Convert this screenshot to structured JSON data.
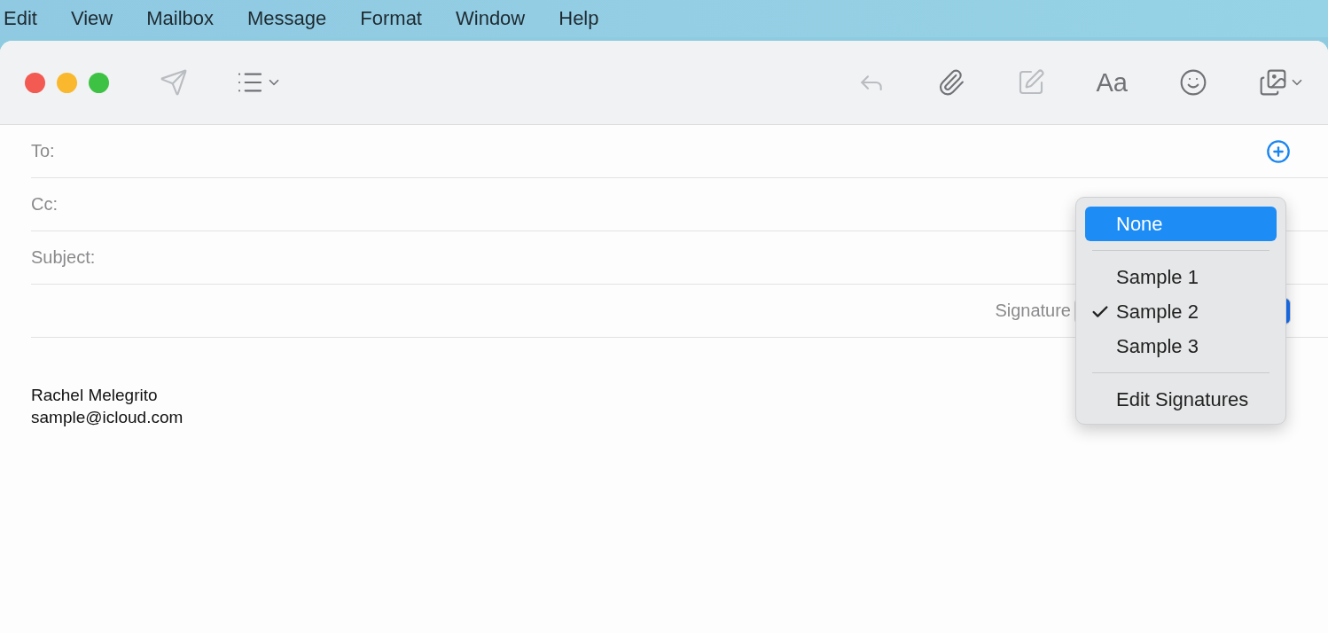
{
  "menu_bar": [
    "Edit",
    "View",
    "Mailbox",
    "Message",
    "Format",
    "Window",
    "Help"
  ],
  "toolbar": {
    "left": [
      {
        "kind": "send",
        "disabled": true
      },
      {
        "kind": "list",
        "disabled": false
      }
    ],
    "right": [
      {
        "kind": "reply",
        "disabled": true
      },
      {
        "kind": "attach",
        "disabled": false
      },
      {
        "kind": "markup",
        "disabled": true
      },
      {
        "kind": "format",
        "label": "Aa",
        "disabled": false
      },
      {
        "kind": "emoji",
        "disabled": false
      },
      {
        "kind": "photo",
        "disabled": false
      }
    ]
  },
  "header_fields": [
    {
      "label": "To:",
      "add_button": true
    },
    {
      "label": "Cc:",
      "add_button": false
    },
    {
      "label": "Subject:",
      "add_button": false
    }
  ],
  "signature": {
    "label": "Signature"
  },
  "body": [
    "Rachel Melegrito",
    "sample@icloud.com"
  ],
  "signature_menu": [
    {
      "kind": "item",
      "label": "None",
      "highlighted": true,
      "checked": false
    },
    {
      "kind": "separator"
    },
    {
      "kind": "item",
      "label": "Sample 1",
      "highlighted": false,
      "checked": false
    },
    {
      "kind": "item",
      "label": "Sample 2",
      "highlighted": false,
      "checked": true
    },
    {
      "kind": "item",
      "label": "Sample 3",
      "highlighted": false,
      "checked": false
    },
    {
      "kind": "separator"
    },
    {
      "kind": "item",
      "label": "Edit Signatures",
      "highlighted": false,
      "checked": false
    }
  ]
}
